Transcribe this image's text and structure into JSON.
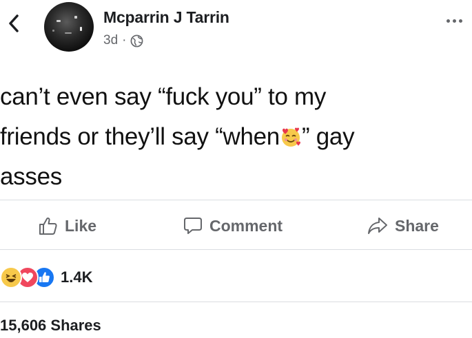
{
  "post": {
    "author": "Mcparrin J Tarrin",
    "time": "3d",
    "separator": "·",
    "text_line1": "can’t even say “fuck you” to my",
    "text_line2_a": "friends or they’ll say “when",
    "text_line2_b": "” gay",
    "text_line3": "asses",
    "emoji": "smiling-face-with-hearts"
  },
  "actions": {
    "like": "Like",
    "comment": "Comment",
    "share": "Share"
  },
  "reactions": {
    "icons": [
      "haha",
      "love",
      "like"
    ],
    "count": "1.4K"
  },
  "shares": "15,606 Shares",
  "colors": {
    "text": "#1c1e21",
    "secondary": "#65676b",
    "like_blue": "#1877f2",
    "love_red": "#f0475d",
    "haha_yellow": "#f7c94b"
  }
}
